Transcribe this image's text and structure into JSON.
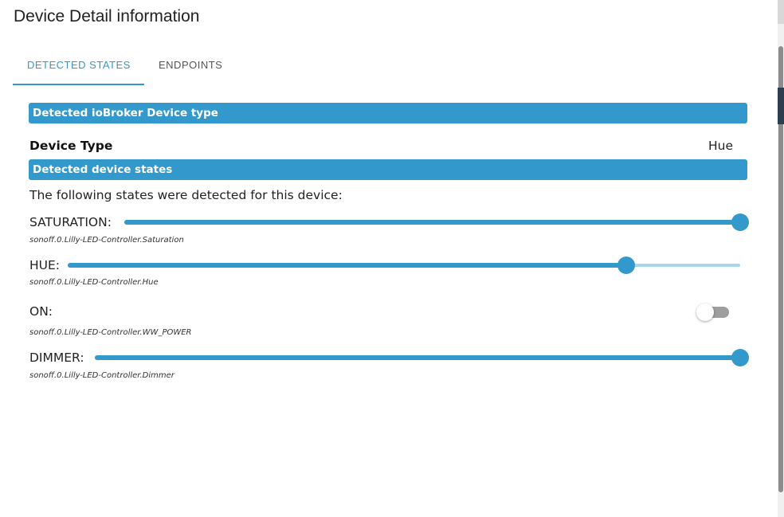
{
  "dialog": {
    "title": "Device Detail information"
  },
  "tabs": [
    {
      "label": "DETECTED STATES",
      "active": true
    },
    {
      "label": "ENDPOINTS",
      "active": false
    }
  ],
  "sections": {
    "device_type_header": "Detected ioBroker Device type",
    "device_states_header": "Detected device states"
  },
  "device_type": {
    "label": "Device Type",
    "value": "Hue"
  },
  "intro_text": "The following states were detected for this device:",
  "states": [
    {
      "label": "SATURATION:",
      "id": "sonoff.0.Lilly-LED-Controller.Saturation",
      "kind": "slider",
      "value_fraction": 1.0
    },
    {
      "label": "HUE:",
      "id": "sonoff.0.Lilly-LED-Controller.Hue",
      "kind": "slider",
      "value_fraction": 0.831
    },
    {
      "label": "ON:",
      "id": "sonoff.0.Lilly-LED-Controller.WW_POWER",
      "kind": "switch",
      "value": false
    },
    {
      "label": "DIMMER:",
      "id": "sonoff.0.Lilly-LED-Controller.Dimmer",
      "kind": "slider",
      "value_fraction": 1.0
    }
  ],
  "colors": {
    "accent": "#3399cc",
    "slider_rail": "#aad6ec",
    "switch_off_track": "#9e9e9e"
  }
}
